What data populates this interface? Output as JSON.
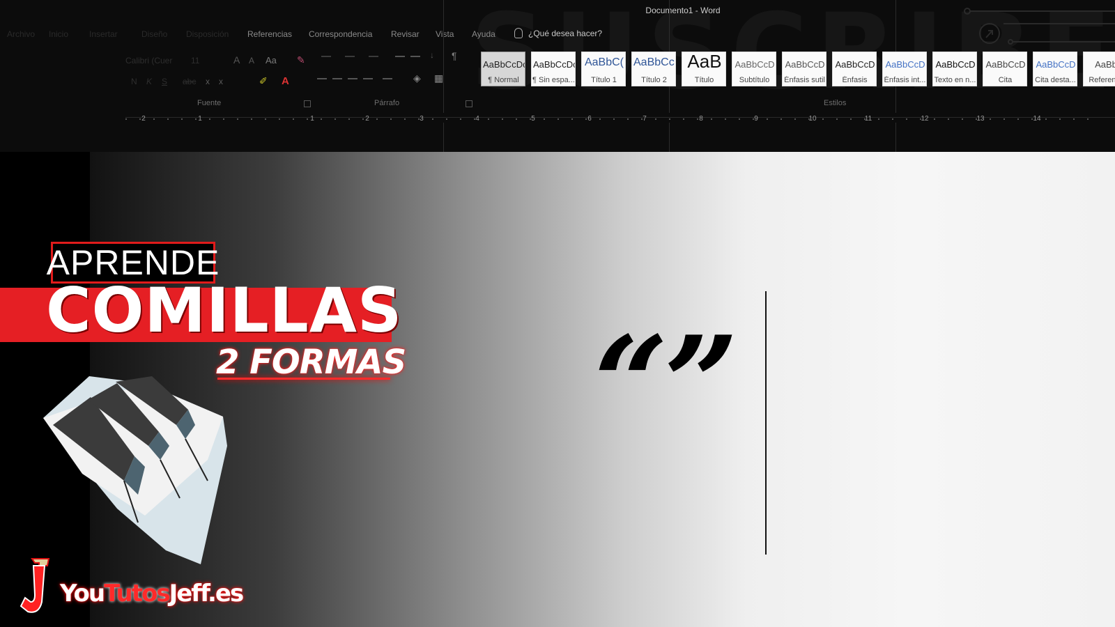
{
  "window": {
    "title": "Documento1  -  Word"
  },
  "menu": [
    {
      "label": "Archivo",
      "dim": true
    },
    {
      "label": "Inicio",
      "dim": true
    },
    {
      "label": "Insertar",
      "dim": true
    },
    {
      "label": "Diseño",
      "dim": true
    },
    {
      "label": "Disposición",
      "dim": true
    },
    {
      "label": "Referencias",
      "dim": false
    },
    {
      "label": "Correspondencia",
      "dim": false
    },
    {
      "label": "Revisar",
      "dim": false
    },
    {
      "label": "Vista",
      "dim": false
    },
    {
      "label": "Ayuda",
      "dim": false
    }
  ],
  "tell_me": "¿Qué desea hacer?",
  "font_group": {
    "font_name": "Calibri (Cuer",
    "font_size": "11",
    "case_button": "Aa",
    "label": "Fuente"
  },
  "paragraph_group": {
    "label": "Párrafo",
    "pilcrow": "¶"
  },
  "styles_group": {
    "label": "Estilos",
    "items": [
      {
        "sample": "AaBbCcDc",
        "name": "¶ Normal",
        "selected": true,
        "color": "#222222"
      },
      {
        "sample": "AaBbCcDc",
        "name": "¶ Sin espa...",
        "selected": false,
        "color": "#222222"
      },
      {
        "sample": "AaBbC(",
        "name": "Título 1",
        "selected": false,
        "color": "#2f5597"
      },
      {
        "sample": "AaBbCcI",
        "name": "Título 2",
        "selected": false,
        "color": "#2f5597"
      },
      {
        "sample": "AaB",
        "name": "Título",
        "selected": false,
        "color": "#111111"
      },
      {
        "sample": "AaBbCcD",
        "name": "Subtítulo",
        "selected": false,
        "color": "#666666"
      },
      {
        "sample": "AaBbCcD",
        "name": "Énfasis sutil",
        "selected": false,
        "color": "#555555"
      },
      {
        "sample": "AaBbCcD",
        "name": "Énfasis",
        "selected": false,
        "color": "#222222"
      },
      {
        "sample": "AaBbCcD",
        "name": "Énfasis int...",
        "selected": false,
        "color": "#4472c4"
      },
      {
        "sample": "AaBbCcD",
        "name": "Texto en n...",
        "selected": false,
        "color": "#111111"
      },
      {
        "sample": "AaBbCcD",
        "name": "Cita",
        "selected": false,
        "color": "#444444"
      },
      {
        "sample": "AaBbCcD",
        "name": "Cita desta...",
        "selected": false,
        "color": "#4472c4"
      },
      {
        "sample": "AaBb",
        "name": "Referen...",
        "selected": false,
        "color": "#444444"
      }
    ]
  },
  "ruler": {
    "numbers": [
      "2",
      "1",
      "1",
      "2",
      "3",
      "4",
      "5",
      "6",
      "7",
      "8",
      "9",
      "10",
      "11",
      "12",
      "13",
      "14"
    ]
  },
  "watermark": "SUSCRIBETE",
  "document": {
    "content": "“”"
  },
  "thumbnail": {
    "line1": "APRENDE",
    "line2": "COMILLAS",
    "line3": "2 FORMAS",
    "accent": "#e51f24",
    "logo": {
      "you": "You",
      "tutos": "Tutos",
      "jeff": "Jeff.es"
    }
  }
}
